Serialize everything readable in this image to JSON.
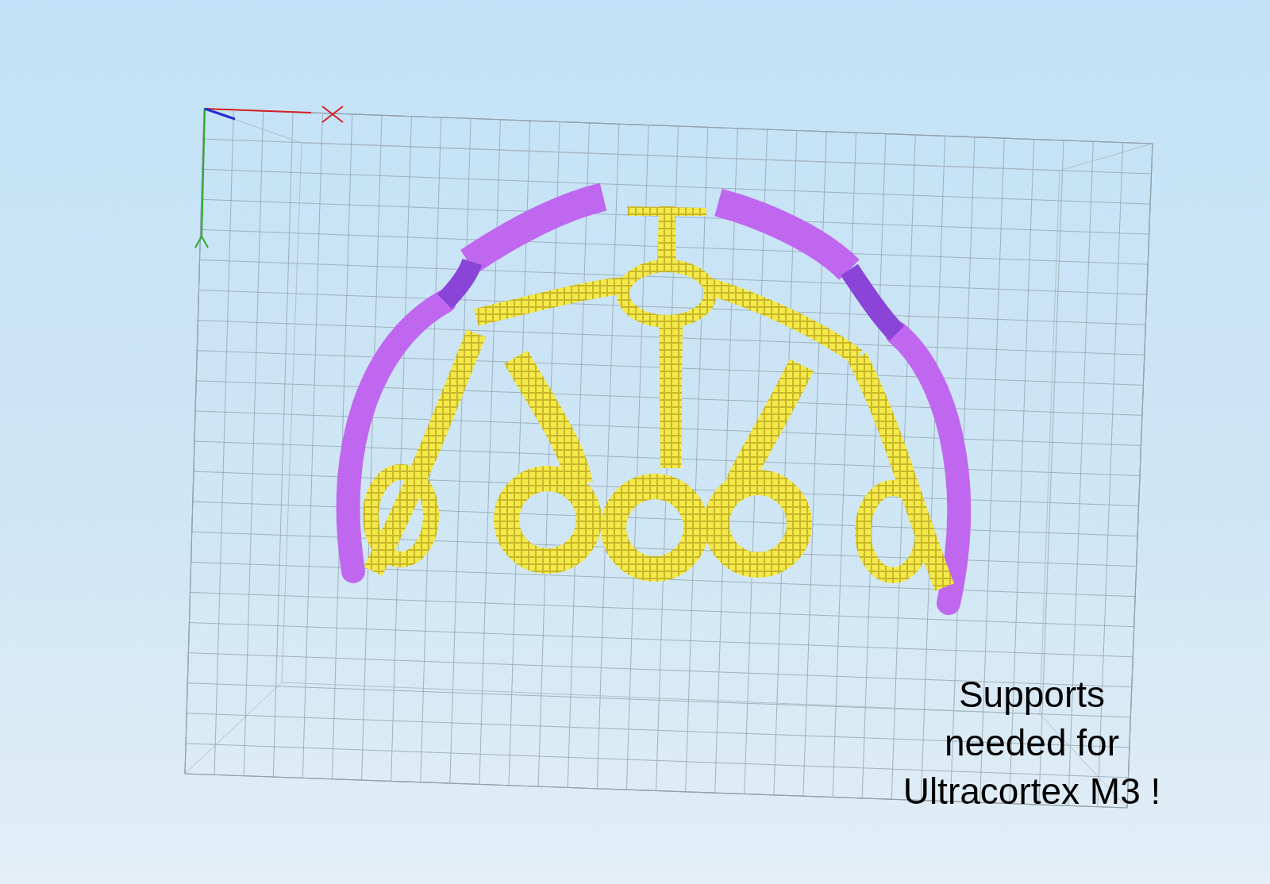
{
  "viewport": {
    "annotation": {
      "lines": [
        "Supports",
        "needed for",
        "Ultracortex M3 !"
      ]
    }
  }
}
